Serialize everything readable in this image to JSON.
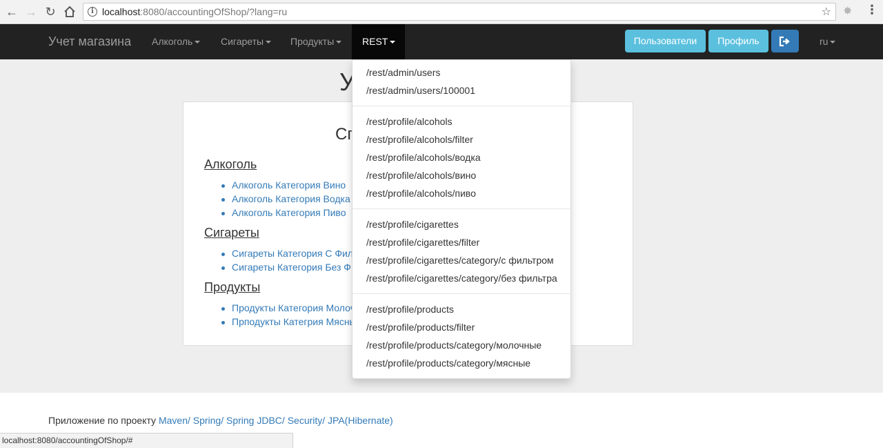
{
  "browser": {
    "url_host": "localhost",
    "url_rest": ":8080/accountingOfShop/?lang=ru",
    "status_url": "localhost:8080/accountingOfShop/#"
  },
  "navbar": {
    "brand": "Учет магазина",
    "items": [
      {
        "label": "Алкоголь"
      },
      {
        "label": "Сигареты"
      },
      {
        "label": "Продукты"
      },
      {
        "label": "REST"
      }
    ],
    "users_button": "Пользователи",
    "profile_button": "Профиль",
    "lang": "ru"
  },
  "main": {
    "title_visible": "У",
    "panel_heading_visible": "Сп",
    "categories": [
      {
        "title": "Алкоголь",
        "links": [
          "Алкоголь Категория Вино",
          "Алкоголь Категория Водка",
          "Алкоголь Категория Пиво"
        ]
      },
      {
        "title": "Сигареты",
        "links": [
          "Сигареты Категория С Фил",
          "Сигареты Категория Без Ф"
        ]
      },
      {
        "title": "Продукты",
        "links": [
          "Продукты Категория Молоч",
          "Пpподукты Категрия Мясны"
        ]
      }
    ]
  },
  "dropdown": {
    "groups": [
      [
        "/rest/admin/users",
        "/rest/admin/users/100001"
      ],
      [
        "/rest/profile/alcohols",
        "/rest/profile/alcohols/filter",
        "/rest/profile/alcohols/водка",
        "/rest/profile/alcohols/вино",
        "/rest/profile/alcohols/пиво"
      ],
      [
        "/rest/profile/cigarettes",
        "/rest/profile/cigarettes/filter",
        "/rest/profile/cigarettes/category/с фильтром",
        "/rest/profile/cigarettes/category/без фильтра"
      ],
      [
        "/rest/profile/products",
        "/rest/profile/products/filter",
        "/rest/profile/products/category/молочные",
        "/rest/profile/products/category/мясные"
      ]
    ]
  },
  "footer": {
    "prefix": "Приложение по проекту ",
    "links": "Maven/ Spring/ Spring JDBC/ Security/ JPA(Hibernate)"
  },
  "colors": {
    "navbar_bg": "#222222",
    "info_button": "#5bc0de",
    "primary_button": "#337ab7",
    "link": "#337ab7"
  }
}
